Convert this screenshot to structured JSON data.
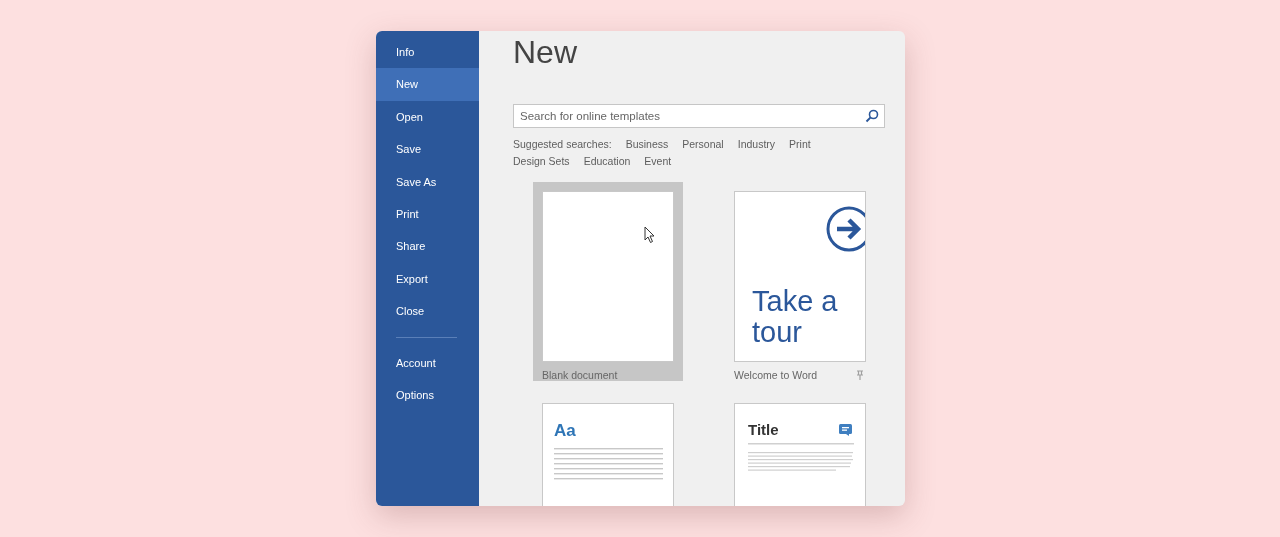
{
  "sidebar": {
    "items": [
      {
        "label": "Info",
        "selected": false
      },
      {
        "label": "New",
        "selected": true
      },
      {
        "label": "Open",
        "selected": false
      },
      {
        "label": "Save",
        "selected": false
      },
      {
        "label": "Save As",
        "selected": false
      },
      {
        "label": "Print",
        "selected": false
      },
      {
        "label": "Share",
        "selected": false
      },
      {
        "label": "Export",
        "selected": false
      },
      {
        "label": "Close",
        "selected": false
      }
    ],
    "bottom_items": [
      {
        "label": "Account",
        "selected": false
      },
      {
        "label": "Options",
        "selected": false
      }
    ]
  },
  "title": "New",
  "search": {
    "placeholder": "Search for online templates"
  },
  "suggested": {
    "label": "Suggested searches:",
    "links": [
      "Business",
      "Personal",
      "Industry",
      "Print",
      "Design Sets",
      "Education",
      "Event"
    ]
  },
  "templates": [
    {
      "kind": "blank",
      "label": "Blank document",
      "selected": true,
      "pinned": false
    },
    {
      "kind": "tour",
      "text": "Take a tour",
      "label": "Welcome to Word",
      "selected": false,
      "pinned": true
    },
    {
      "kind": "theme",
      "text": "Aa",
      "selected": false,
      "pinned": false
    },
    {
      "kind": "title",
      "text": "Title",
      "selected": false,
      "pinned": false
    }
  ]
}
